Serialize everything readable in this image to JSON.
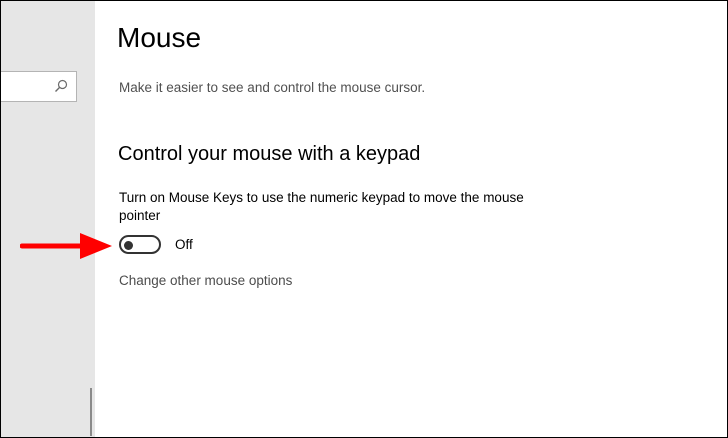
{
  "sidebar": {
    "search": {
      "value": "",
      "icon": "search-icon"
    }
  },
  "main": {
    "title": "Mouse",
    "description": "Make it easier to see and control the mouse cursor.",
    "section": {
      "heading": "Control your mouse with a keypad",
      "mouse_keys": {
        "label": "Turn on Mouse Keys to use the numeric keypad to move the mouse pointer",
        "state_text": "Off",
        "on": false
      },
      "link": "Change other mouse options"
    }
  },
  "annotation": {
    "icon": "arrow-right-icon",
    "color": "#ff0000"
  },
  "colors": {
    "sidebar_bg": "#e6e6e6",
    "toggle_off": "#333333",
    "secondary_text": "#505050"
  }
}
